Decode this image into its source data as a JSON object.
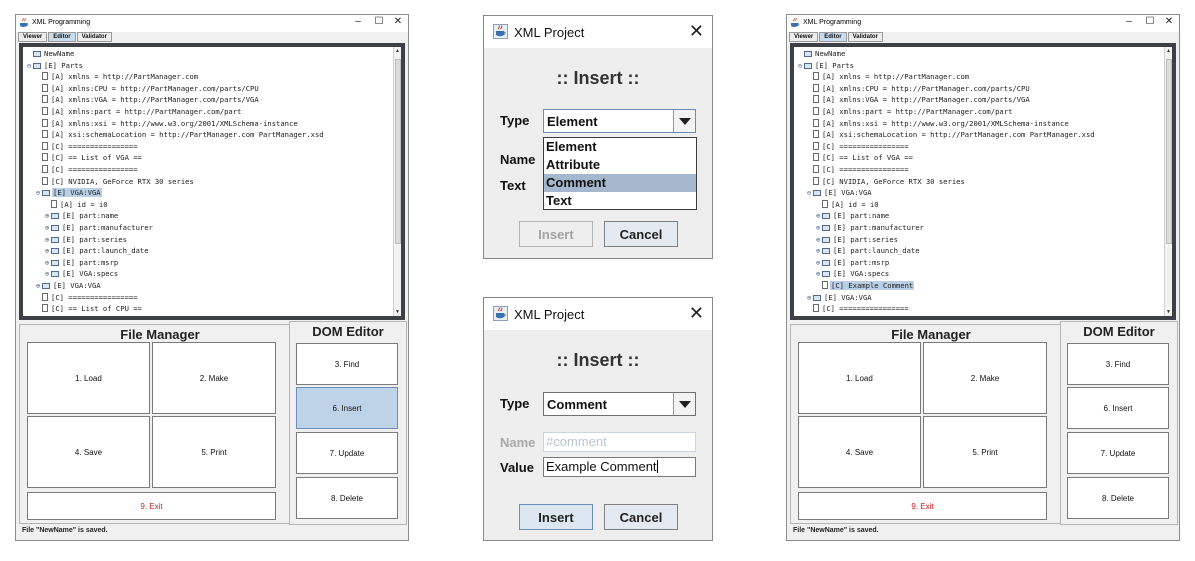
{
  "window_left": {
    "title": "XML Programming",
    "controls": [
      "–",
      "☐",
      "✕"
    ],
    "tabs": [
      {
        "label": "Viewer",
        "active": false
      },
      {
        "label": "Editor",
        "active": true
      },
      {
        "label": "Validator",
        "active": false
      }
    ],
    "tree": [
      {
        "indent": 0,
        "toggle": "",
        "icon": "folder",
        "text": "NewName",
        "selected": false
      },
      {
        "indent": 0,
        "toggle": "⊖",
        "icon": "folder",
        "text": "[E] Parts",
        "selected": false
      },
      {
        "indent": 1,
        "toggle": "",
        "icon": "doc",
        "text": "[A] xmlns = http://PartManager.com",
        "selected": false
      },
      {
        "indent": 1,
        "toggle": "",
        "icon": "doc",
        "text": "[A] xmlns:CPU = http://PartManager.com/parts/CPU",
        "selected": false
      },
      {
        "indent": 1,
        "toggle": "",
        "icon": "doc",
        "text": "[A] xmlns:VGA = http://PartManager.com/parts/VGA",
        "selected": false
      },
      {
        "indent": 1,
        "toggle": "",
        "icon": "doc",
        "text": "[A] xmlns:part = http://PartManager.com/part",
        "selected": false
      },
      {
        "indent": 1,
        "toggle": "",
        "icon": "doc",
        "text": "[A] xmlns:xsi = http://www.w3.org/2001/XMLSchema-instance",
        "selected": false
      },
      {
        "indent": 1,
        "toggle": "",
        "icon": "doc",
        "text": "[A] xsi:schemaLocation = http://PartManager.com PartManager.xsd",
        "selected": false
      },
      {
        "indent": 1,
        "toggle": "",
        "icon": "doc",
        "text": "[C] ================",
        "selected": false
      },
      {
        "indent": 1,
        "toggle": "",
        "icon": "doc",
        "text": "[C] == List of VGA ==",
        "selected": false
      },
      {
        "indent": 1,
        "toggle": "",
        "icon": "doc",
        "text": "[C] ================",
        "selected": false
      },
      {
        "indent": 1,
        "toggle": "",
        "icon": "doc",
        "text": "[C] NVIDIA, GeForce RTX 30 series",
        "selected": false
      },
      {
        "indent": 1,
        "toggle": "⊖",
        "icon": "folder",
        "text": "[E] VGA:VGA",
        "selected": true
      },
      {
        "indent": 2,
        "toggle": "",
        "icon": "doc",
        "text": "[A] id = i0",
        "selected": false
      },
      {
        "indent": 2,
        "toggle": "⊕",
        "icon": "folder",
        "text": "[E] part:name",
        "selected": false
      },
      {
        "indent": 2,
        "toggle": "⊕",
        "icon": "folder",
        "text": "[E] part:manufacturer",
        "selected": false
      },
      {
        "indent": 2,
        "toggle": "⊕",
        "icon": "folder",
        "text": "[E] part:series",
        "selected": false
      },
      {
        "indent": 2,
        "toggle": "⊕",
        "icon": "folder",
        "text": "[E] part:launch_date",
        "selected": false
      },
      {
        "indent": 2,
        "toggle": "⊕",
        "icon": "folder",
        "text": "[E] part:msrp",
        "selected": false
      },
      {
        "indent": 2,
        "toggle": "⊕",
        "icon": "folder",
        "text": "[E] VGA:specs",
        "selected": false
      },
      {
        "indent": 1,
        "toggle": "⊕",
        "icon": "folder",
        "text": "[E] VGA:VGA",
        "selected": false
      },
      {
        "indent": 1,
        "toggle": "",
        "icon": "doc",
        "text": "[C] ================",
        "selected": false
      },
      {
        "indent": 1,
        "toggle": "",
        "icon": "doc",
        "text": "[C] == List of CPU ==",
        "selected": false
      }
    ],
    "file_manager": {
      "title": "File Manager",
      "buttons": [
        {
          "label": "1. Load",
          "active": false,
          "exit": false
        },
        {
          "label": "2. Make",
          "active": false,
          "exit": false
        },
        {
          "label": "4. Save",
          "active": false,
          "exit": false
        },
        {
          "label": "5. Print",
          "active": false,
          "exit": false
        },
        {
          "label": "9. Exit",
          "active": false,
          "exit": true
        }
      ]
    },
    "dom_editor": {
      "title": "DOM Editor",
      "buttons": [
        {
          "label": "3. Find",
          "active": false
        },
        {
          "label": "6. Insert",
          "active": true
        },
        {
          "label": "7. Update",
          "active": false
        },
        {
          "label": "8. Delete",
          "active": false
        }
      ]
    },
    "status": "File \"NewName\" is saved."
  },
  "window_right": {
    "title": "XML Programming",
    "controls": [
      "–",
      "☐",
      "✕"
    ],
    "tabs": [
      {
        "label": "Viewer",
        "active": false
      },
      {
        "label": "Editor",
        "active": true
      },
      {
        "label": "Validator",
        "active": false
      }
    ],
    "tree": [
      {
        "indent": 0,
        "toggle": "",
        "icon": "folder",
        "text": "NewName",
        "selected": false
      },
      {
        "indent": 0,
        "toggle": "⊖",
        "icon": "folder",
        "text": "[E] Parts",
        "selected": false
      },
      {
        "indent": 1,
        "toggle": "",
        "icon": "doc",
        "text": "[A] xmlns = http://PartManager.com",
        "selected": false
      },
      {
        "indent": 1,
        "toggle": "",
        "icon": "doc",
        "text": "[A] xmlns:CPU = http://PartManager.com/parts/CPU",
        "selected": false
      },
      {
        "indent": 1,
        "toggle": "",
        "icon": "doc",
        "text": "[A] xmlns:VGA = http://PartManager.com/parts/VGA",
        "selected": false
      },
      {
        "indent": 1,
        "toggle": "",
        "icon": "doc",
        "text": "[A] xmlns:part = http://PartManager.com/part",
        "selected": false
      },
      {
        "indent": 1,
        "toggle": "",
        "icon": "doc",
        "text": "[A] xmlns:xsi = http://www.w3.org/2001/XMLSchema-instance",
        "selected": false
      },
      {
        "indent": 1,
        "toggle": "",
        "icon": "doc",
        "text": "[A] xsi:schemaLocation = http://PartManager.com PartManager.xsd",
        "selected": false
      },
      {
        "indent": 1,
        "toggle": "",
        "icon": "doc",
        "text": "[C] ================",
        "selected": false
      },
      {
        "indent": 1,
        "toggle": "",
        "icon": "doc",
        "text": "[C] == List of VGA ==",
        "selected": false
      },
      {
        "indent": 1,
        "toggle": "",
        "icon": "doc",
        "text": "[C] ================",
        "selected": false
      },
      {
        "indent": 1,
        "toggle": "",
        "icon": "doc",
        "text": "[C] NVIDIA, GeForce RTX 30 series",
        "selected": false
      },
      {
        "indent": 1,
        "toggle": "⊖",
        "icon": "folder",
        "text": "[E] VGA:VGA",
        "selected": false
      },
      {
        "indent": 2,
        "toggle": "",
        "icon": "doc",
        "text": "[A] id = i0",
        "selected": false
      },
      {
        "indent": 2,
        "toggle": "⊕",
        "icon": "folder",
        "text": "[E] part:name",
        "selected": false
      },
      {
        "indent": 2,
        "toggle": "⊕",
        "icon": "folder",
        "text": "[E] part:manufacturer",
        "selected": false
      },
      {
        "indent": 2,
        "toggle": "⊕",
        "icon": "folder",
        "text": "[E] part:series",
        "selected": false
      },
      {
        "indent": 2,
        "toggle": "⊕",
        "icon": "folder",
        "text": "[E] part:launch_date",
        "selected": false
      },
      {
        "indent": 2,
        "toggle": "⊕",
        "icon": "folder",
        "text": "[E] part:msrp",
        "selected": false
      },
      {
        "indent": 2,
        "toggle": "⊕",
        "icon": "folder",
        "text": "[E] VGA:specs",
        "selected": false
      },
      {
        "indent": 2,
        "toggle": "",
        "icon": "doc",
        "text": "[C] Example Comment",
        "selected": true
      },
      {
        "indent": 1,
        "toggle": "⊕",
        "icon": "folder",
        "text": "[E] VGA:VGA",
        "selected": false
      },
      {
        "indent": 1,
        "toggle": "",
        "icon": "doc",
        "text": "[C] ================",
        "selected": false
      }
    ],
    "file_manager": {
      "title": "File Manager",
      "buttons": [
        {
          "label": "1. Load",
          "active": false,
          "exit": false
        },
        {
          "label": "2. Make",
          "active": false,
          "exit": false
        },
        {
          "label": "4. Save",
          "active": false,
          "exit": false
        },
        {
          "label": "5. Print",
          "active": false,
          "exit": false
        },
        {
          "label": "9. Exit",
          "active": false,
          "exit": true
        }
      ]
    },
    "dom_editor": {
      "title": "DOM Editor",
      "buttons": [
        {
          "label": "3. Find",
          "active": false
        },
        {
          "label": "6. Insert",
          "active": false
        },
        {
          "label": "7. Update",
          "active": false
        },
        {
          "label": "8. Delete",
          "active": false
        }
      ]
    },
    "status": "File \"NewName\" is saved."
  },
  "dialog_type_select": {
    "title": "XML Project",
    "close": "✕",
    "heading": ":: Insert ::",
    "type_label": "Type",
    "type_value": "Element",
    "name_label": "Name",
    "text_label": "Text",
    "options": [
      "Element",
      "Attribute",
      "Comment",
      "Text"
    ],
    "highlighted_option": "Comment",
    "insert_label": "Insert",
    "cancel_label": "Cancel"
  },
  "dialog_comment": {
    "title": "XML Project",
    "close": "✕",
    "heading": ":: Insert ::",
    "type_label": "Type",
    "type_value": "Comment",
    "name_label": "Name",
    "name_placeholder": "#comment",
    "value_label": "Value",
    "value": "Example Comment",
    "insert_label": "Insert",
    "cancel_label": "Cancel"
  },
  "colors": {
    "selection": "#b8cfe5",
    "active_button": "#bfd3e8",
    "exit_text": "#c81e1e",
    "tree_frame": "#3d4046",
    "dropdown_highlight": "#a4b7cc"
  }
}
